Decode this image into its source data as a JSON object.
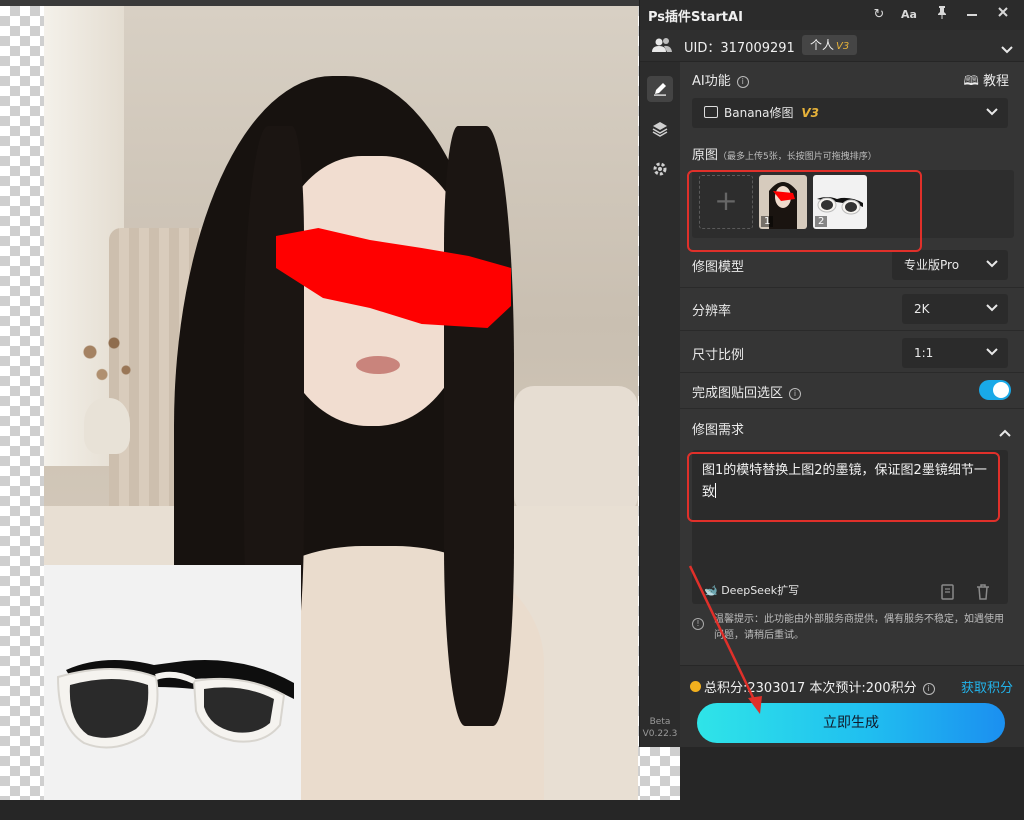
{
  "panel": {
    "title": "Ps插件StartAI",
    "titlebar_icons": [
      "refresh-icon",
      "font-size-icon",
      "pin-icon",
      "minimize-icon",
      "close-icon"
    ],
    "font_button_label": "Aa",
    "user": {
      "uid": "UID：317009291",
      "plan": "个人",
      "plan_version": "V3"
    },
    "side_tools": [
      "edit-icon",
      "layers-icon",
      "settings-icon"
    ],
    "version_line1": "Beta",
    "version_line2": "V0.22.3"
  },
  "ai_function": {
    "label": "AI功能",
    "tutorial_label": "教程",
    "selected": "Banana修图",
    "selected_version": "V3"
  },
  "source_images": {
    "label": "原图",
    "hint": "（最多上传5张，长按图片可拖拽排序）",
    "thumbnails": [
      {
        "index": "1",
        "description": "portrait"
      },
      {
        "index": "2",
        "description": "sunglasses"
      }
    ]
  },
  "settings": {
    "model_label": "修图模型",
    "model_value": "专业版Pro",
    "resolution_label": "分辨率",
    "resolution_value": "2K",
    "ratio_label": "尺寸比例",
    "ratio_value": "1:1",
    "paste_back_label": "完成图贴回选区",
    "paste_back_enabled": true
  },
  "prompt": {
    "label": "修图需求",
    "text": "图1的模特替换上图2的墨镜，保证图2墨镜细节一致",
    "deepseek_label": "DeepSeek扩写"
  },
  "tip": {
    "text": "温馨提示：此功能由外部服务商提供，偶有服务不稳定，如遇使用问题，请稍后重试。"
  },
  "footer": {
    "credits_text": "总积分:2303017  本次预计:200积分",
    "get_credits_label": "获取积分",
    "generate_label": "立即生成"
  },
  "colors": {
    "accent": "#1fb3ea",
    "annotation_red": "#e0302a",
    "coin": "#f2b01e",
    "version_gold": "#e6b23a"
  }
}
